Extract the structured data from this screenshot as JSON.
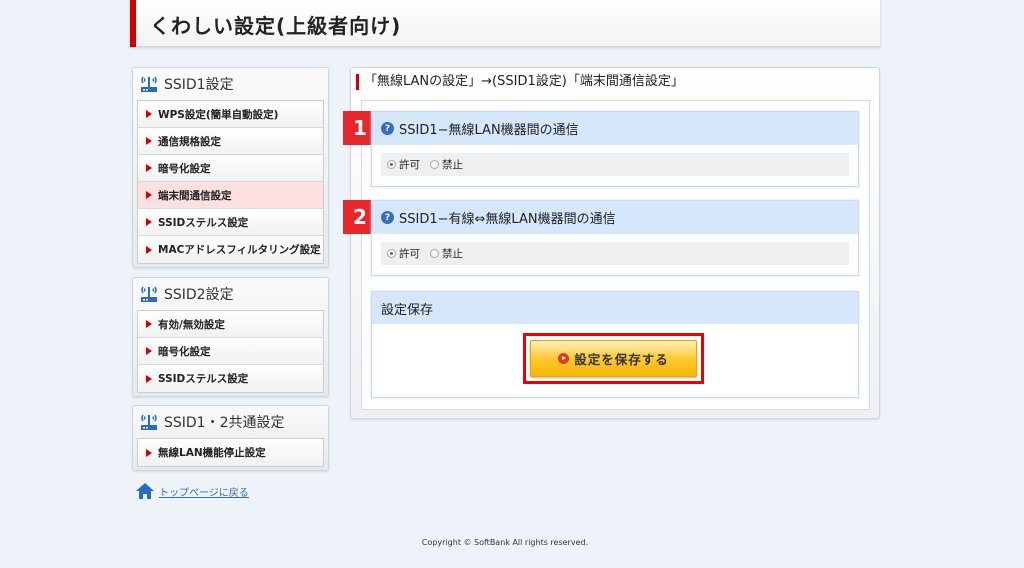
{
  "header": {
    "title": "くわしい設定(上級者向け)"
  },
  "sidebar": [
    {
      "title": "SSID1設定",
      "items": [
        {
          "label": "WPS設定(簡単自動設定)"
        },
        {
          "label": "通信規格設定"
        },
        {
          "label": "暗号化設定"
        },
        {
          "label": "端末間通信設定",
          "active": true
        },
        {
          "label": "SSIDステルス設定"
        },
        {
          "label": "MACアドレスフィルタリング設定"
        }
      ]
    },
    {
      "title": "SSID2設定",
      "items": [
        {
          "label": "有効/無効設定"
        },
        {
          "label": "暗号化設定"
        },
        {
          "label": "SSIDステルス設定"
        }
      ]
    },
    {
      "title": "SSID1・2共通設定",
      "items": [
        {
          "label": "無線LAN機能停止設定"
        }
      ]
    }
  ],
  "home_link": "トップページに戻る",
  "main": {
    "title": "「無線LANの設定」→(SSID1設定)「端末間通信設定」",
    "sections": [
      {
        "badge": "1",
        "title": "SSID1−無線LAN機器間の通信",
        "options": [
          "許可",
          "禁止"
        ],
        "selected": "許可"
      },
      {
        "badge": "2",
        "title": "SSID1−有線⇔無線LAN機器間の通信",
        "options": [
          "許可",
          "禁止"
        ],
        "selected": "許可"
      }
    ],
    "save": {
      "title": "設定保存",
      "button": "設定を保存する"
    }
  },
  "footer": "Copyright © SoftBank All rights reserved."
}
